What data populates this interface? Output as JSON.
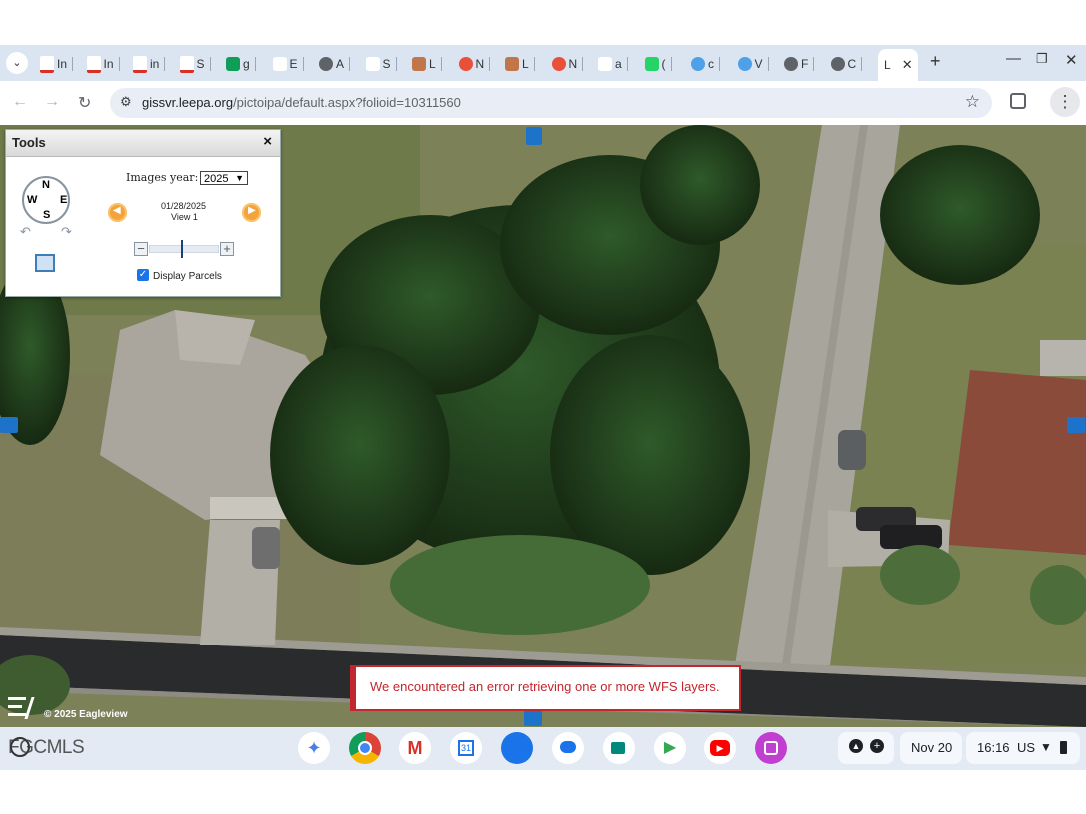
{
  "browser": {
    "tabs": [
      {
        "label": "In",
        "icon": "gmail-icon"
      },
      {
        "label": "In",
        "icon": "gmail-icon"
      },
      {
        "label": "in",
        "icon": "gmail-icon"
      },
      {
        "label": "S",
        "icon": "gmail-icon"
      },
      {
        "label": "g",
        "icon": "sheets-icon"
      },
      {
        "label": "E",
        "icon": "openai-icon"
      },
      {
        "label": "A",
        "icon": "globe-icon"
      },
      {
        "label": "S",
        "icon": "settings-icon"
      },
      {
        "label": "L",
        "icon": "layers-icon"
      },
      {
        "label": "N",
        "icon": "target-icon"
      },
      {
        "label": "L",
        "icon": "layers-icon"
      },
      {
        "label": "N",
        "icon": "target-icon"
      },
      {
        "label": "a",
        "icon": "person-icon"
      },
      {
        "label": "(",
        "icon": "whatsapp-icon"
      },
      {
        "label": "c",
        "icon": "smile-icon"
      },
      {
        "label": "V",
        "icon": "ring-icon"
      },
      {
        "label": "F",
        "icon": "globe-icon"
      },
      {
        "label": "C",
        "icon": "globe-icon"
      },
      {
        "label": "L",
        "icon": "none"
      }
    ],
    "new_tab": "+",
    "url_host": "gissvr.leepa.org",
    "url_path": "/pictoipa/default.aspx?folioid=10311560"
  },
  "tools": {
    "title": "Tools",
    "close": "×",
    "images_year_label": "Images year:",
    "images_year_value": "2025",
    "image_date": "01/28/2025",
    "image_view": "View 1",
    "display_parcels_label": "Display Parcels",
    "display_parcels_checked": true,
    "compass": {
      "n": "N",
      "s": "S",
      "e": "E",
      "w": "W"
    }
  },
  "map": {
    "copyright": "© 2025 Eagleview",
    "watermark": "FGCMLS",
    "error_message": "We encountered an error retrieving one or more WFS layers."
  },
  "shelf": {
    "apps": [
      "gemini-icon",
      "chrome-icon",
      "gmail-icon",
      "calendar-icon",
      "files-icon",
      "chat-icon",
      "meet-icon",
      "play-store-icon",
      "youtube-icon",
      "app-icon"
    ],
    "calendar_day": "31",
    "date": "Nov 20",
    "time": "16:16",
    "locale": "US"
  },
  "colors": {
    "error": "#c1272d",
    "accent": "#1a73e8"
  }
}
